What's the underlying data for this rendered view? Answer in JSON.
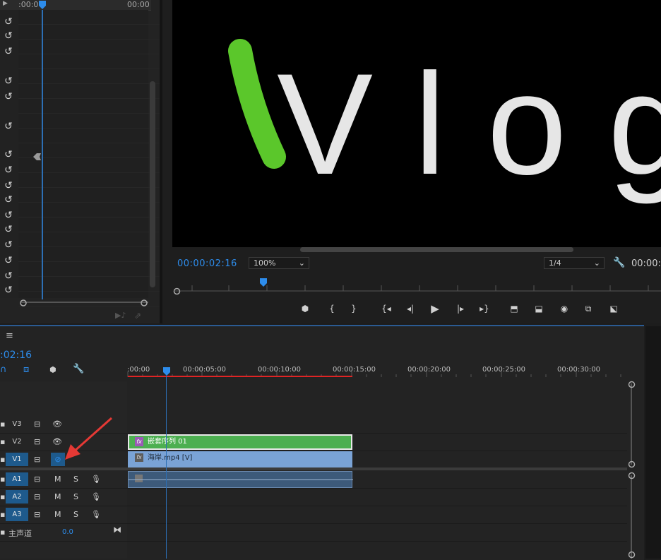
{
  "effect_controls": {
    "ruler_start": ":00:0",
    "ruler_end": "00:00",
    "reset_icon": "↺"
  },
  "program": {
    "title_text": "Vlog",
    "timecode": "00:00:02:16",
    "zoom": "100%",
    "resolution": "1/4",
    "timecode_right": "00:00:",
    "controls": [
      "marker-icon",
      "mark-in-icon",
      "mark-out-icon",
      "go-to-in-icon",
      "step-back-icon",
      "play-icon",
      "step-forward-icon",
      "go-to-out-icon",
      "lift-icon",
      "extract-icon",
      "export-frame-icon",
      "comparison-view-icon",
      "multi-cam-icon"
    ]
  },
  "timeline": {
    "menu_icon": "≡",
    "timecode": ":02:16",
    "ruler_labels": [
      ":00:00",
      "00:00:05:00",
      "00:00:10:00",
      "00:00:15:00",
      "00:00:20:00",
      "00:00:25:00",
      "00:00:30:00"
    ],
    "tracks": [
      {
        "name": "V3",
        "type": "video"
      },
      {
        "name": "V2",
        "type": "video"
      },
      {
        "name": "V1",
        "type": "video"
      },
      {
        "name": "A1",
        "type": "audio"
      },
      {
        "name": "A2",
        "type": "audio"
      },
      {
        "name": "A3",
        "type": "audio"
      }
    ],
    "master_label": "主声道",
    "master_value": "0.0",
    "clip_nested": "嵌套序列 01",
    "clip_video": "海岸.mp4 [V]",
    "mute_label": "M",
    "solo_label": "S",
    "fx_label": "fx"
  },
  "colors": {
    "accent": "#2d8ceb",
    "clip_green": "#4caf50",
    "clip_blue": "#7aa3d6",
    "annotation": "#e53935"
  }
}
